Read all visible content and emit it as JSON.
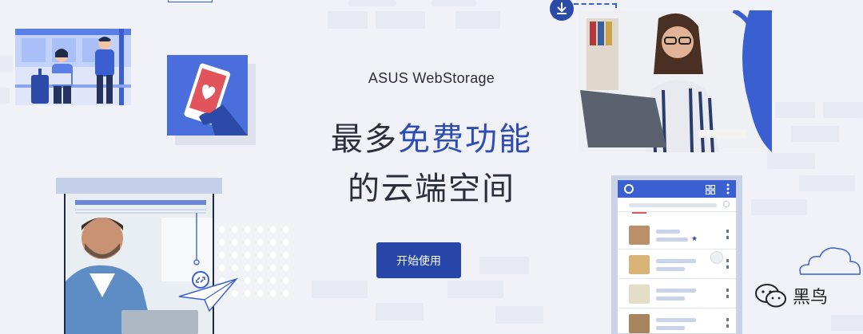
{
  "hero": {
    "brand": "ASUS WebStorage",
    "headline_plain_1": "最多",
    "headline_highlight": "免费功能",
    "headline_line_2": "的云端空间",
    "cta_label": "开始使用"
  },
  "watermark": {
    "text": "黑鸟"
  },
  "colors": {
    "background": "#f1f2f8",
    "accent": "#2846a8",
    "highlight": "#2e4db3",
    "text": "#2b2f3a"
  },
  "icons": [
    "download-icon",
    "link-icon",
    "paper-plane-icon",
    "cloud-icon",
    "wechat-icon",
    "grid-icon",
    "more-icon",
    "star-icon",
    "search-icon",
    "heart-icon"
  ]
}
